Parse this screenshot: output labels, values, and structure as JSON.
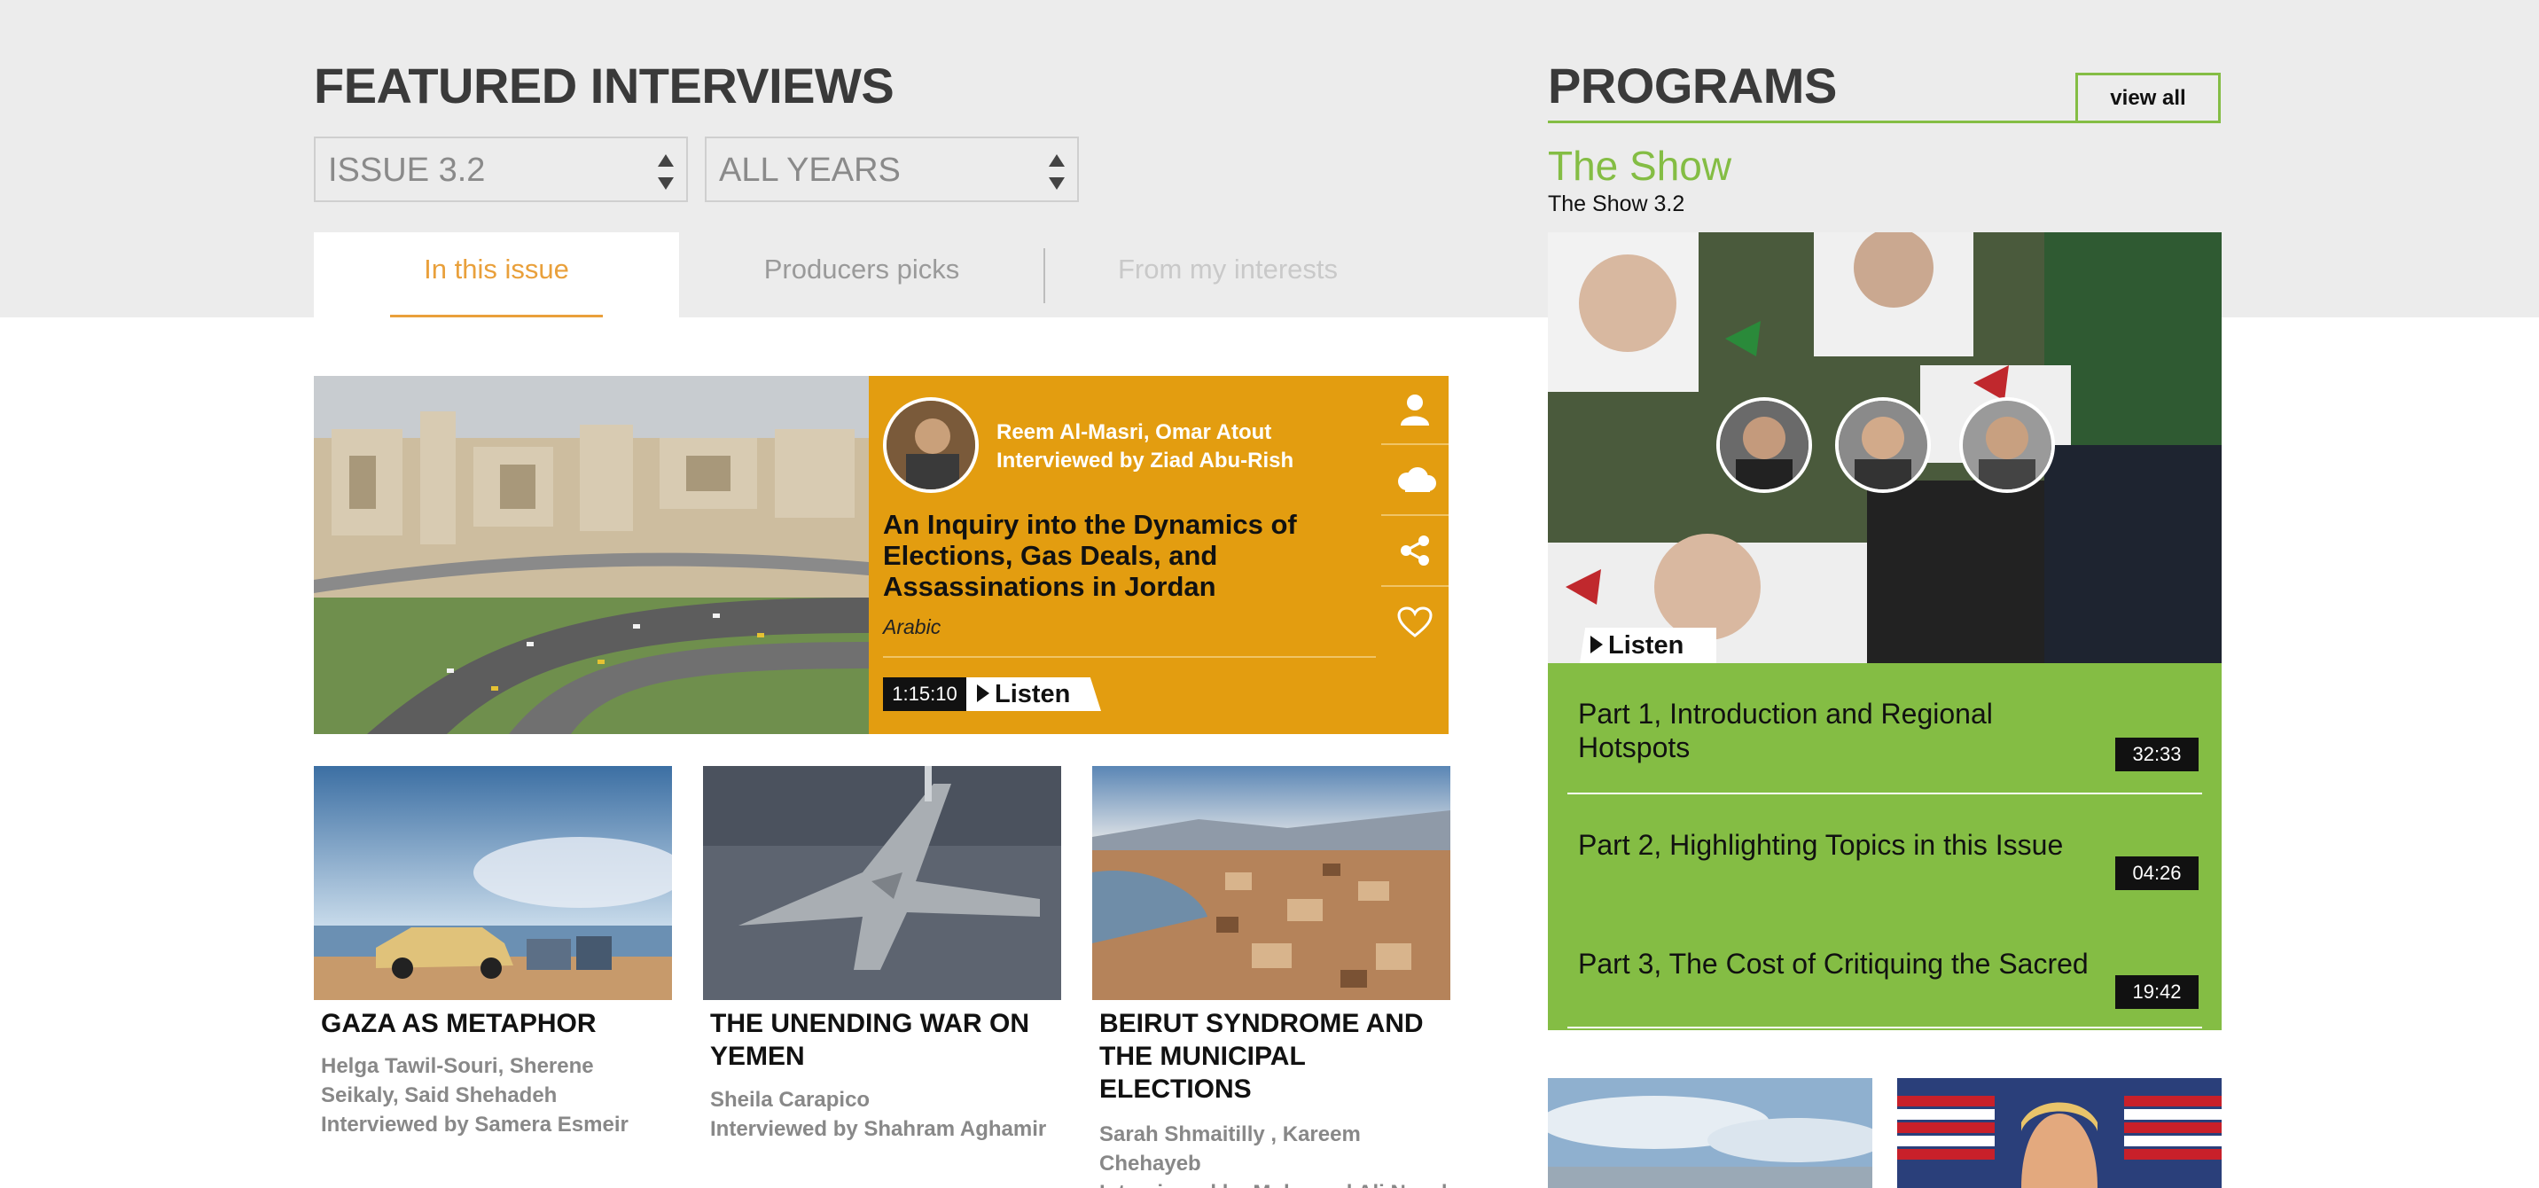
{
  "featured": {
    "heading": "FEATURED INTERVIEWS",
    "issue_select": "ISSUE 3.2",
    "year_select": "ALL YEARS",
    "tabs": [
      {
        "label": "In this issue",
        "active": true
      },
      {
        "label": "Producers picks",
        "active": false
      },
      {
        "label": "From my interests",
        "active": false
      }
    ],
    "main_card": {
      "authors": "Reem Al-Masri, Omar Atout",
      "interviewer": "Interviewed by Ziad Abu-Rish",
      "title": "An Inquiry into the Dynamics of Elections, Gas Deals, and Assassinations in Jordan",
      "language": "Arabic",
      "duration": "1:15:10",
      "listen_label": "Listen",
      "side_icons": [
        "user-icon",
        "cloud-icon",
        "share-icon",
        "heart-icon"
      ]
    },
    "cards": [
      {
        "title": "GAZA AS METAPHOR",
        "authors": "Helga Tawil-Souri, Sherene Seikaly, Said Shehadeh",
        "interviewer": "Interviewed by Samera Esmeir"
      },
      {
        "title": "THE UNENDING WAR ON YEMEN",
        "authors": "Sheila Carapico",
        "interviewer": "Interviewed by Shahram Aghamir"
      },
      {
        "title": "BEIRUT SYNDROME AND THE MUNICIPAL ELECTIONS",
        "authors": "Sarah Shmaitilly , Kareem Chehayeb",
        "interviewer": "Interviewed by Mohamad Ali Nayel"
      }
    ]
  },
  "programs": {
    "heading": "PROGRAMS",
    "view_all": "view all",
    "show_title": "The Show",
    "show_subtitle": "The Show 3.2",
    "listen_label": "Listen",
    "episodes": [
      {
        "title": "Part 1, Introduction and Regional Hotspots",
        "duration": "32:33"
      },
      {
        "title": "Part 2, Highlighting Topics in this Issue",
        "duration": "04:26"
      },
      {
        "title": "Part 3, The Cost of Critiquing the Sacred",
        "duration": "19:42"
      }
    ]
  },
  "colors": {
    "accent_orange": "#e39d10",
    "tab_orange": "#e9a03b",
    "program_green": "#84bd44",
    "band_gray": "#ececec"
  }
}
